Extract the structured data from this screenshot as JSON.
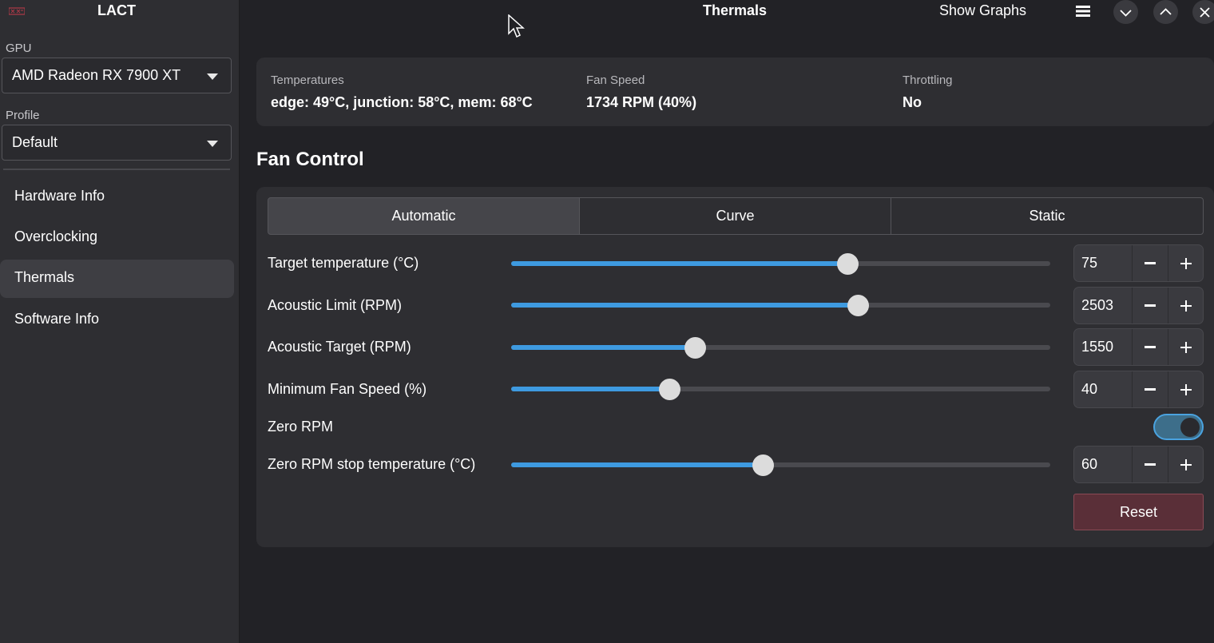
{
  "app": {
    "title": "LACT"
  },
  "sidebar": {
    "gpu_label": "GPU",
    "gpu_value": "AMD Radeon RX 7900 XT",
    "profile_label": "Profile",
    "profile_value": "Default",
    "nav": [
      {
        "label": "Hardware Info",
        "active": false
      },
      {
        "label": "Overclocking",
        "active": false
      },
      {
        "label": "Thermals",
        "active": true
      },
      {
        "label": "Software Info",
        "active": false
      }
    ]
  },
  "header": {
    "title": "Thermals",
    "show_graphs": "Show Graphs",
    "icons": [
      "menu-icon",
      "minimize-icon",
      "maximize-icon",
      "close-icon"
    ]
  },
  "stats": {
    "temperatures_label": "Temperatures",
    "temperatures_value": "edge: 49°C, junction: 58°C, mem: 68°C",
    "fan_speed_label": "Fan Speed",
    "fan_speed_value": "1734 RPM (40%)",
    "throttling_label": "Throttling",
    "throttling_value": "No"
  },
  "fan_control": {
    "heading": "Fan Control",
    "tabs": [
      {
        "label": "Automatic",
        "active": true
      },
      {
        "label": "Curve",
        "active": false
      },
      {
        "label": "Static",
        "active": false
      }
    ],
    "target_temp": {
      "label": "Target temperature (°C)",
      "value": "75",
      "fraction": 0.623
    },
    "acoustic_limit": {
      "label": "Acoustic Limit (RPM)",
      "value": "2503",
      "fraction": 0.643
    },
    "acoustic_target": {
      "label": "Acoustic Target (RPM)",
      "value": "1550",
      "fraction": 0.341
    },
    "min_fan_speed": {
      "label": "Minimum Fan Speed (%)",
      "value": "40",
      "fraction": 0.293
    },
    "zero_rpm": {
      "label": "Zero RPM",
      "enabled": true
    },
    "zero_rpm_stop_temp": {
      "label": "Zero RPM stop temperature (°C)",
      "value": "60",
      "fraction": 0.467
    },
    "reset_label": "Reset"
  },
  "colors": {
    "accent": "#3e9ae0",
    "background": "#222226",
    "panel": "#2e2e32",
    "reset": "#5a2f38"
  }
}
